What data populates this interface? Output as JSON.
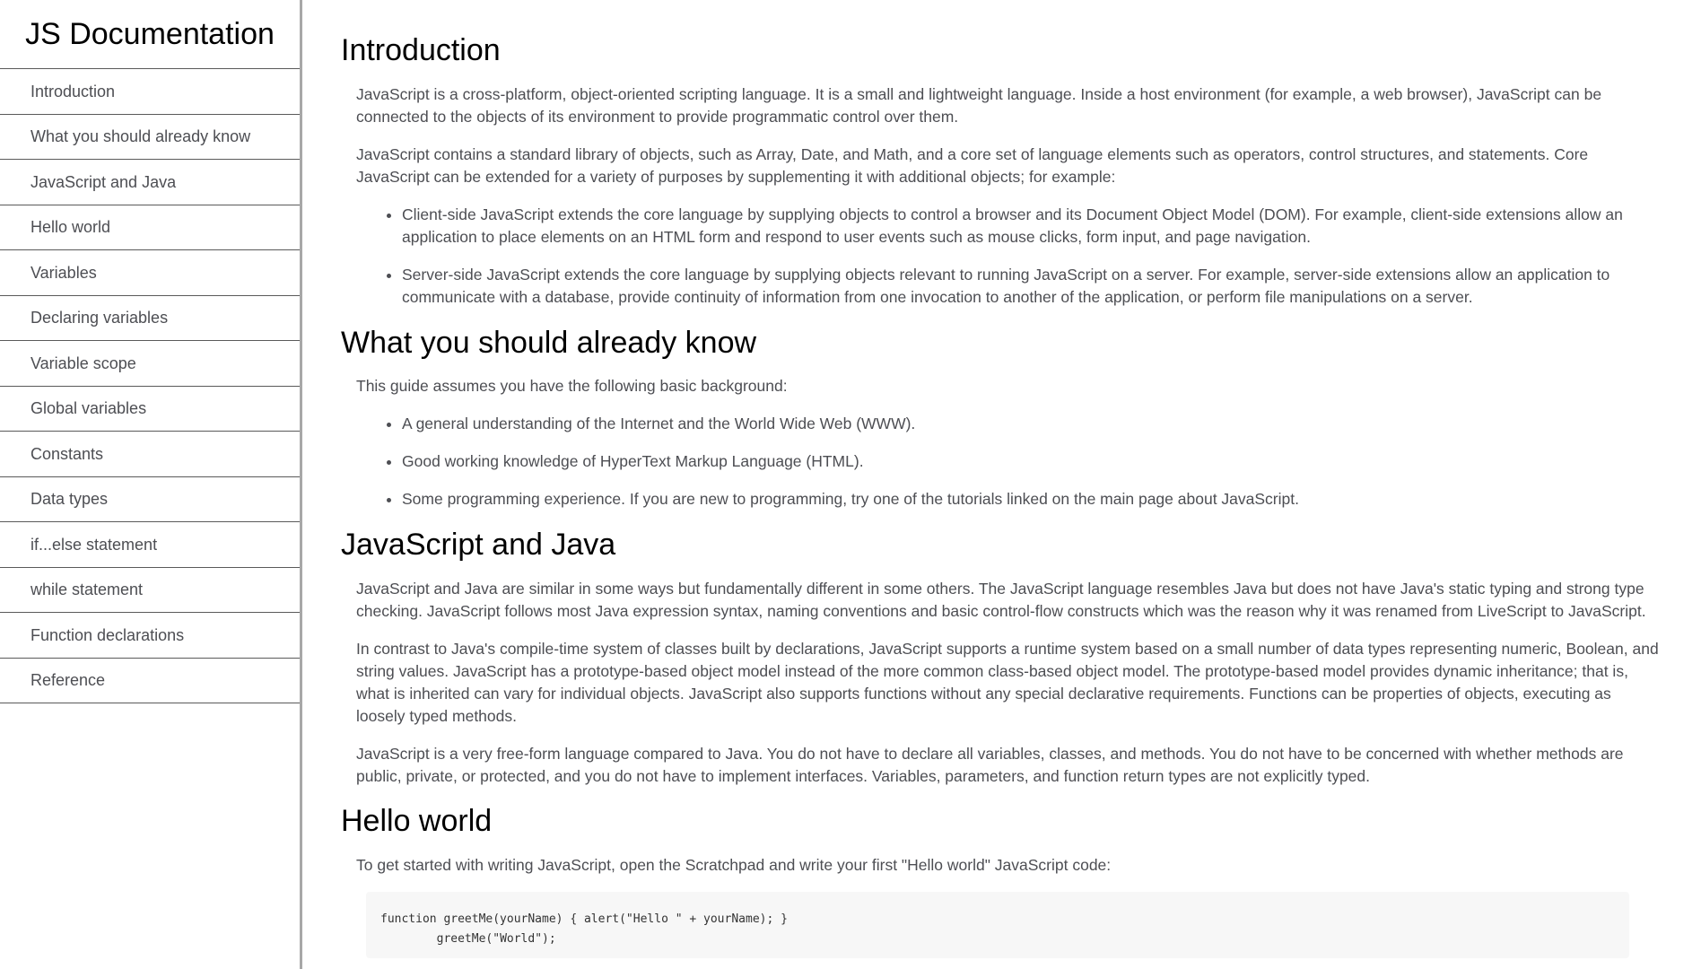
{
  "nav": {
    "title": "JS Documentation",
    "items": [
      {
        "label": "Introduction"
      },
      {
        "label": "What you should already know"
      },
      {
        "label": "JavaScript and Java"
      },
      {
        "label": "Hello world"
      },
      {
        "label": "Variables"
      },
      {
        "label": "Declaring variables"
      },
      {
        "label": "Variable scope"
      },
      {
        "label": "Global variables"
      },
      {
        "label": "Constants"
      },
      {
        "label": "Data types"
      },
      {
        "label": "if...else statement"
      },
      {
        "label": "while statement"
      },
      {
        "label": "Function declarations"
      },
      {
        "label": "Reference"
      }
    ]
  },
  "sections": {
    "introduction": {
      "title": "Introduction",
      "p1": "JavaScript is a cross-platform, object-oriented scripting language. It is a small and lightweight language. Inside a host environment (for example, a web browser), JavaScript can be connected to the objects of its environment to provide programmatic control over them.",
      "p2": "JavaScript contains a standard library of objects, such as Array, Date, and Math, and a core set of language elements such as operators, control structures, and statements. Core JavaScript can be extended for a variety of purposes by supplementing it with additional objects; for example:",
      "list": [
        "Client-side JavaScript extends the core language by supplying objects to control a browser and its Document Object Model (DOM). For example, client-side extensions allow an application to place elements on an HTML form and respond to user events such as mouse clicks, form input, and page navigation.",
        "Server-side JavaScript extends the core language by supplying objects relevant to running JavaScript on a server. For example, server-side extensions allow an application to communicate with a database, provide continuity of information from one invocation to another of the application, or perform file manipulations on a server."
      ]
    },
    "know": {
      "title": "What you should already know",
      "p1": "This guide assumes you have the following basic background:",
      "list": [
        "A general understanding of the Internet and the World Wide Web (WWW).",
        "Good working knowledge of HyperText Markup Language (HTML).",
        "Some programming experience. If you are new to programming, try one of the tutorials linked on the main page about JavaScript."
      ]
    },
    "java": {
      "title": "JavaScript and Java",
      "p1": "JavaScript and Java are similar in some ways but fundamentally different in some others. The JavaScript language resembles Java but does not have Java's static typing and strong type checking. JavaScript follows most Java expression syntax, naming conventions and basic control-flow constructs which was the reason why it was renamed from LiveScript to JavaScript.",
      "p2": "In contrast to Java's compile-time system of classes built by declarations, JavaScript supports a runtime system based on a small number of data types representing numeric, Boolean, and string values. JavaScript has a prototype-based object model instead of the more common class-based object model. The prototype-based model provides dynamic inheritance; that is, what is inherited can vary for individual objects. JavaScript also supports functions without any special declarative requirements. Functions can be properties of objects, executing as loosely typed methods.",
      "p3": "JavaScript is a very free-form language compared to Java. You do not have to declare all variables, classes, and methods. You do not have to be concerned with whether methods are public, private, or protected, and you do not have to implement interfaces. Variables, parameters, and function return types are not explicitly typed."
    },
    "hello": {
      "title": "Hello world",
      "p1": "To get started with writing JavaScript, open the Scratchpad and write your first \"Hello world\" JavaScript code:",
      "code_line1": "function greetMe(yourName) { alert(\"Hello \" + yourName); }",
      "code_line2": "greetMe(\"World\");"
    }
  }
}
